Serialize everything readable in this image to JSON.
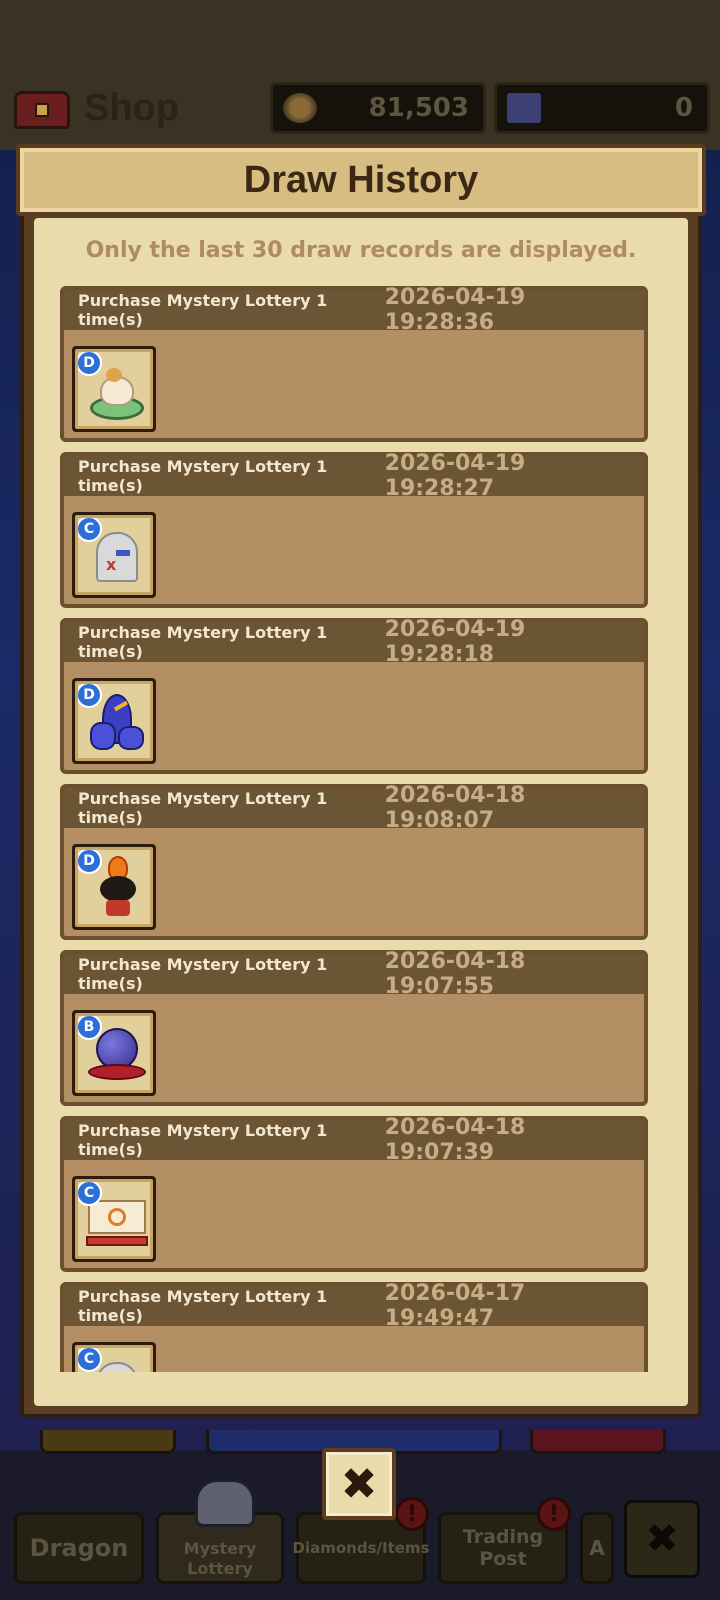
{
  "header": {
    "title": "Shop",
    "gold_amount": "81,503",
    "gem_amount": "0",
    "shop_icon": "treasure-chest-icon",
    "gold_icon": "compass-coin-icon",
    "gem_icon": "ticket-icon"
  },
  "bottom_tabs": {
    "dragon": "Dragon",
    "lottery_line1": "Mystery",
    "lottery_line2": "Lottery",
    "diamonds": "Diamonds/Items",
    "trading": "Trading Post",
    "partial": "A",
    "alert_mark": "!",
    "close_glyph": "✖"
  },
  "modal": {
    "title": "Draw History",
    "notice": "Only the last 30 draw records are displayed.",
    "close_glyph": "✖"
  },
  "records": [
    {
      "label": "Purchase Mystery Lottery 1 time(s)",
      "time": "2026-04-19 19:28:36",
      "grade": "D",
      "item_icon": "cake-icon"
    },
    {
      "label": "Purchase Mystery Lottery 1 time(s)",
      "time": "2026-04-19 19:28:27",
      "grade": "C",
      "item_icon": "tombstone-icon"
    },
    {
      "label": "Purchase Mystery Lottery 1 time(s)",
      "time": "2026-04-19 19:28:18",
      "grade": "D",
      "item_icon": "blue-rock-icon"
    },
    {
      "label": "Purchase Mystery Lottery 1 time(s)",
      "time": "2026-04-18 19:08:07",
      "grade": "D",
      "item_icon": "fire-creature-icon"
    },
    {
      "label": "Purchase Mystery Lottery 1 time(s)",
      "time": "2026-04-18 19:07:55",
      "grade": "B",
      "item_icon": "crystal-ball-icon"
    },
    {
      "label": "Purchase Mystery Lottery 1 time(s)",
      "time": "2026-04-18 19:07:39",
      "grade": "C",
      "item_icon": "sign-board-icon"
    },
    {
      "label": "Purchase Mystery Lottery 1 time(s)",
      "time": "2026-04-17 19:49:47",
      "grade": "C",
      "item_icon": "tombstone-icon"
    }
  ]
}
